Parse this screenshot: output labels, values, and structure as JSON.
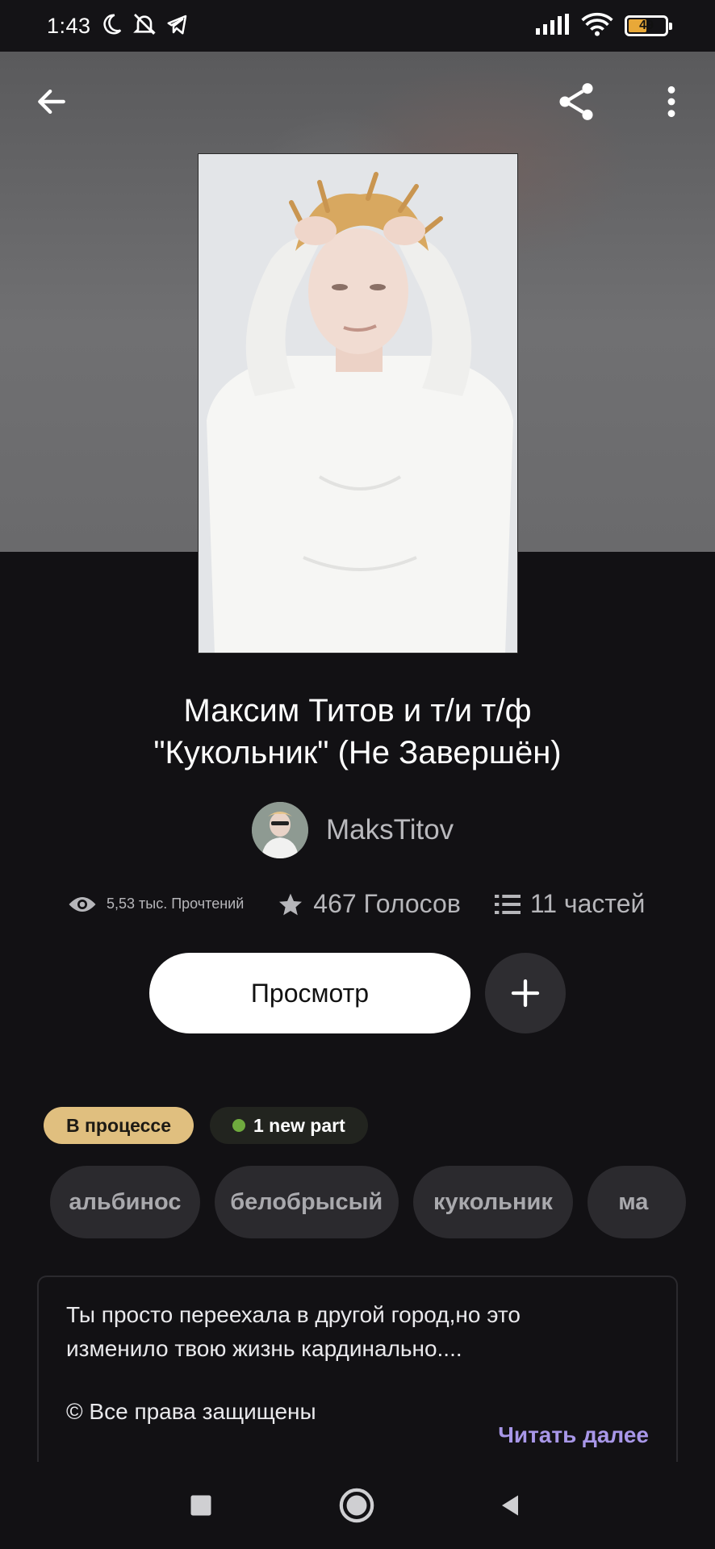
{
  "status_bar": {
    "time": "1:43",
    "battery_level": "49",
    "battery_fill_percent": 49
  },
  "header": {
    "icons": [
      "back-arrow-icon",
      "share-icon",
      "more-vertical-icon"
    ]
  },
  "story": {
    "title_line1": "Максим Титов и т/и т/ф",
    "title_line2": "\"Кукольник\" (Не Завершён)",
    "author": "MaksTitov",
    "reads": "5,53 тыс. Прочтений",
    "votes": "467 Голосов",
    "parts": "11 частей"
  },
  "actions": {
    "view_label": "Просмотр"
  },
  "badges": {
    "status": "В процессе",
    "new_parts": "1 new part"
  },
  "tags": [
    "альбинос",
    "белобрысый",
    "кукольник",
    "ма"
  ],
  "description": {
    "line1": "Ты просто переехала в другой город,но это",
    "line2": "изменило твою жизнь кардинально....",
    "copyright": "© Все права защищены",
    "read_more": "Читать далее"
  },
  "colors": {
    "background": "#121114",
    "status_badge": "#e0bf7f",
    "new_dot": "#6faa3e",
    "read_more": "#a897e8",
    "battery": "#e8a838"
  }
}
